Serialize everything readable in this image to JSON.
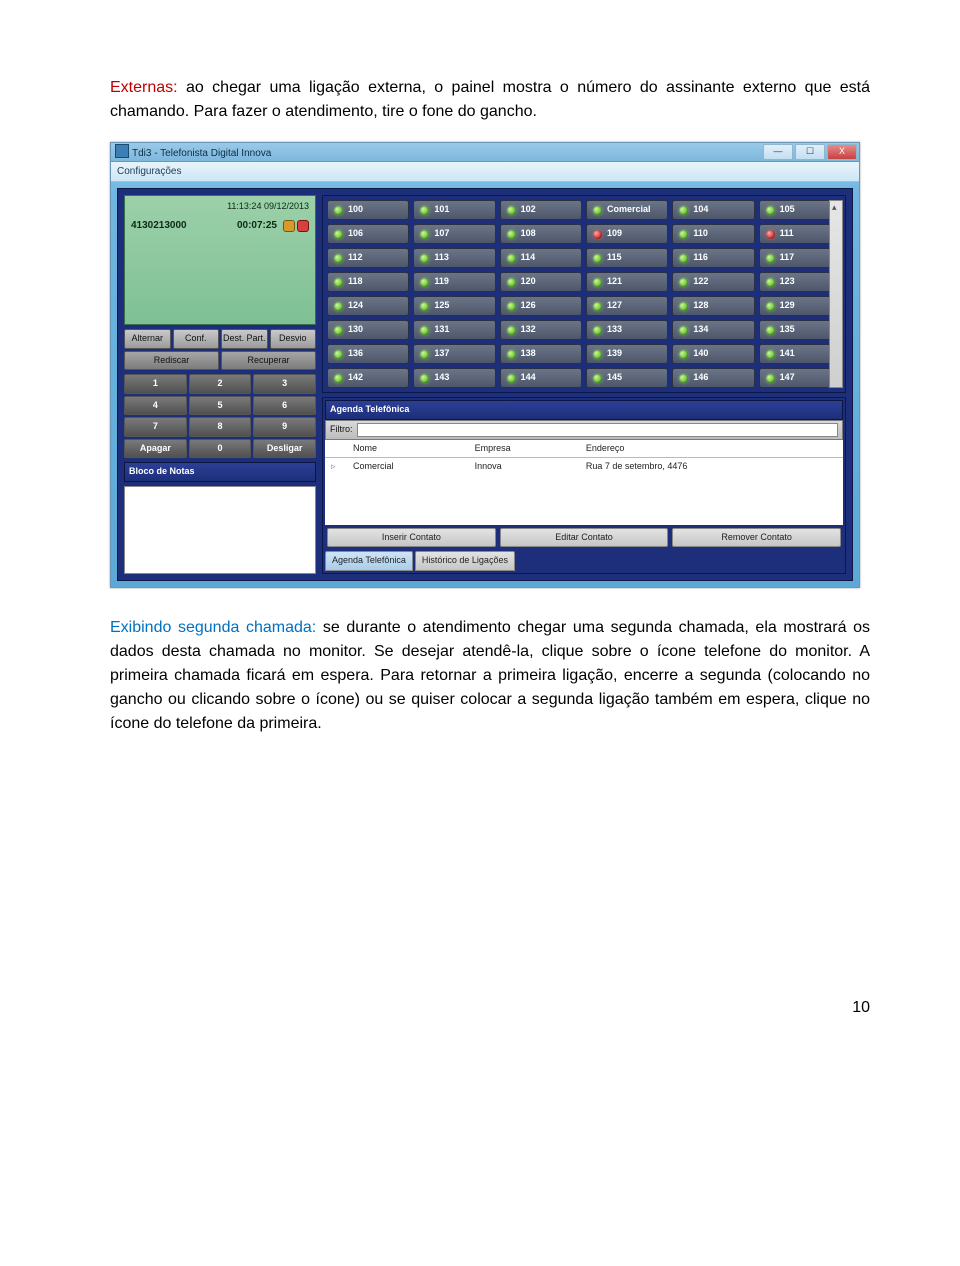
{
  "para1": {
    "heading": "Externas:",
    "text": " ao chegar uma ligação externa, o painel  mostra o número do assinante externo que está chamando. Para fazer o atendimento, tire o fone do gancho."
  },
  "win": {
    "title": "Tdi3 - Telefonista Digital Innova",
    "menu": "Configurações",
    "ctrl_min": "—",
    "ctrl_max": "☐",
    "ctrl_close": "X"
  },
  "monitor": {
    "datetime": "11:13:24 09/12/2013",
    "number": "4130213000",
    "duration": "00:07:25"
  },
  "action_buttons": {
    "row1": [
      "Alternar",
      "Conf.",
      "Dest. Part.",
      "Desvio"
    ],
    "row2": [
      "Rediscar",
      "Recuperar"
    ]
  },
  "keypad": {
    "rows": [
      [
        "1",
        "2",
        "3"
      ],
      [
        "4",
        "5",
        "6"
      ],
      [
        "7",
        "8",
        "9"
      ],
      [
        "Apagar",
        "0",
        "Desligar"
      ]
    ]
  },
  "notes_title": "Bloco de Notas",
  "extensions": [
    {
      "label": "100",
      "state": "green"
    },
    {
      "label": "101",
      "state": "green"
    },
    {
      "label": "102",
      "state": "green"
    },
    {
      "label": "Comercial",
      "state": "green"
    },
    {
      "label": "104",
      "state": "green"
    },
    {
      "label": "105",
      "state": "green"
    },
    {
      "label": "106",
      "state": "green"
    },
    {
      "label": "107",
      "state": "green"
    },
    {
      "label": "108",
      "state": "green"
    },
    {
      "label": "109",
      "state": "red"
    },
    {
      "label": "110",
      "state": "green"
    },
    {
      "label": "111",
      "state": "red"
    },
    {
      "label": "112",
      "state": "green"
    },
    {
      "label": "113",
      "state": "green"
    },
    {
      "label": "114",
      "state": "green"
    },
    {
      "label": "115",
      "state": "green"
    },
    {
      "label": "116",
      "state": "green"
    },
    {
      "label": "117",
      "state": "green"
    },
    {
      "label": "118",
      "state": "green"
    },
    {
      "label": "119",
      "state": "green"
    },
    {
      "label": "120",
      "state": "green"
    },
    {
      "label": "121",
      "state": "green"
    },
    {
      "label": "122",
      "state": "green"
    },
    {
      "label": "123",
      "state": "green"
    },
    {
      "label": "124",
      "state": "green"
    },
    {
      "label": "125",
      "state": "green"
    },
    {
      "label": "126",
      "state": "green"
    },
    {
      "label": "127",
      "state": "green"
    },
    {
      "label": "128",
      "state": "green"
    },
    {
      "label": "129",
      "state": "green"
    },
    {
      "label": "130",
      "state": "green"
    },
    {
      "label": "131",
      "state": "green"
    },
    {
      "label": "132",
      "state": "green"
    },
    {
      "label": "133",
      "state": "green"
    },
    {
      "label": "134",
      "state": "green"
    },
    {
      "label": "135",
      "state": "green"
    },
    {
      "label": "136",
      "state": "green"
    },
    {
      "label": "137",
      "state": "green"
    },
    {
      "label": "138",
      "state": "green"
    },
    {
      "label": "139",
      "state": "green"
    },
    {
      "label": "140",
      "state": "green"
    },
    {
      "label": "141",
      "state": "green"
    },
    {
      "label": "142",
      "state": "green"
    },
    {
      "label": "143",
      "state": "green"
    },
    {
      "label": "144",
      "state": "green"
    },
    {
      "label": "145",
      "state": "green"
    },
    {
      "label": "146",
      "state": "green"
    },
    {
      "label": "147",
      "state": "green"
    }
  ],
  "agenda": {
    "title": "Agenda Telefônica",
    "filtro_label": "Filtro:",
    "headers": [
      "Nome",
      "Empresa",
      "Endereço"
    ],
    "row": {
      "nome": "Comercial",
      "empresa": "Innova",
      "endereco": "Rua 7 de setembro, 4476"
    },
    "buttons": [
      "Inserir Contato",
      "Editar Contato",
      "Remover Contato"
    ],
    "tabs": [
      "Agenda Telefônica",
      "Histórico de Ligações"
    ]
  },
  "para2": {
    "heading": "Exibindo segunda chamada:",
    "text": " se durante o atendimento chegar uma segunda chamada, ela mostrará os dados desta chamada no monitor. Se desejar atendê-la, clique sobre o ícone telefone do monitor. A primeira chamada ficará em espera. Para retornar a primeira ligação, encerre a segunda (colocando no gancho ou clicando sobre o ícone) ou se quiser colocar a segunda ligação também em espera, clique no ícone do telefone da primeira."
  },
  "page_number": "10"
}
